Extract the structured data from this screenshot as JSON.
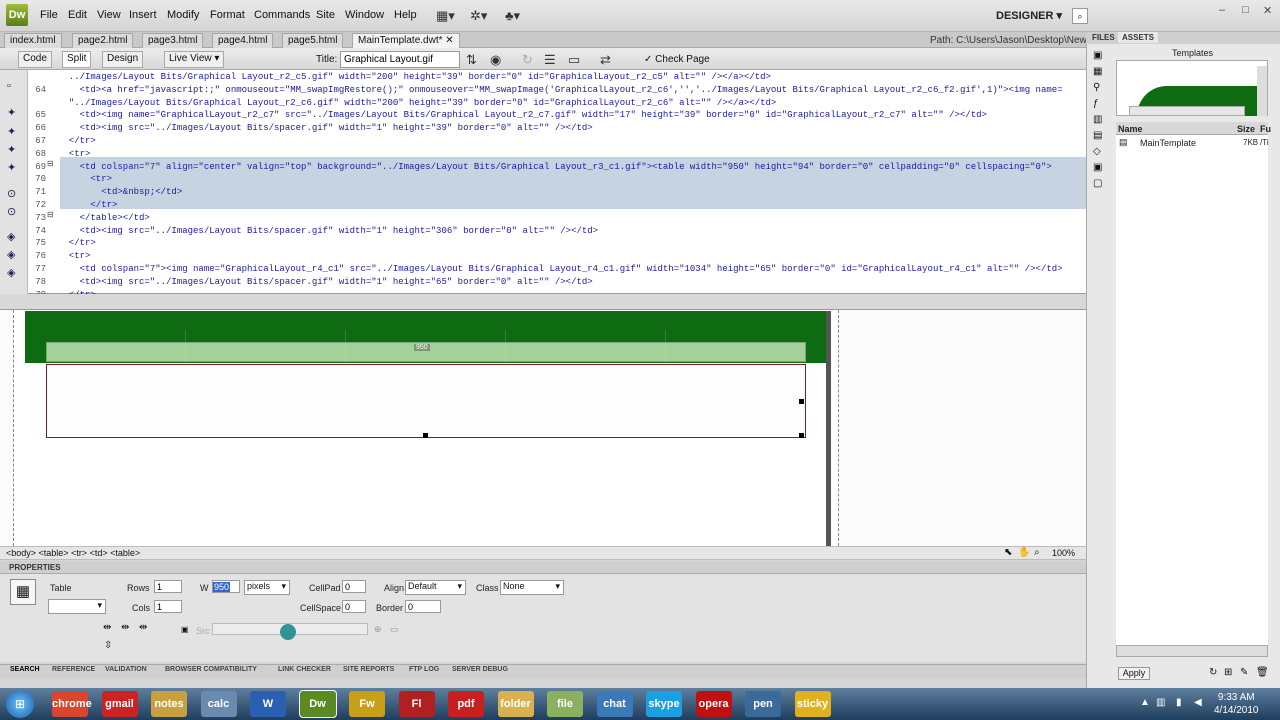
{
  "app": {
    "logo": "Dw",
    "workspace": "DESIGNER",
    "search_icon": "⌕"
  },
  "menu": [
    "File",
    "Edit",
    "View",
    "Insert",
    "Modify",
    "Format",
    "Commands",
    "Site",
    "Window",
    "Help"
  ],
  "window_controls": [
    "‒",
    "□",
    "✕"
  ],
  "doc_tabs": [
    "index.html",
    "page2.html",
    "page3.html",
    "page4.html",
    "page5.html",
    "MainTemplate.dwt*"
  ],
  "path": "Path:  C:\\Users\\Jason\\Desktop\\New Tr",
  "toolbar": {
    "code": "Code",
    "split": "Split",
    "design": "Design",
    "live_view": "Live View",
    "title_label": "Title:",
    "title_value": "Graphical Layout.gif",
    "check_page": "Check Page"
  },
  "code_lines": [
    {
      "n": "",
      "t": "  ../Images/Layout Bits/Graphical Layout_r2_c5.gif\" width=\"200\" height=\"39\" border=\"0\" id=\"GraphicalLayout_r2_c5\" alt=\"\" /></a></td>"
    },
    {
      "n": "64",
      "t": "    <td><a href=\"javascript:;\" onmouseout=\"MM_swapImgRestore();\" onmouseover=\"MM_swapImage('GraphicalLayout_r2_c6','','../Images/Layout Bits/Graphical Layout_r2_c6_f2.gif',1)\"><img name="
    },
    {
      "n": "",
      "t": "  \"../Images/Layout Bits/Graphical Layout_r2_c6.gif\" width=\"200\" height=\"39\" border=\"0\" id=\"GraphicalLayout_r2_c6\" alt=\"\" /></a></td>"
    },
    {
      "n": "65",
      "t": "    <td><img name=\"GraphicalLayout_r2_c7\" src=\"../Images/Layout Bits/Graphical Layout_r2_c7.gif\" width=\"17\" height=\"39\" border=\"0\" id=\"GraphicalLayout_r2_c7\" alt=\"\" /></td>"
    },
    {
      "n": "66",
      "t": "    <td><img src=\"../Images/Layout Bits/spacer.gif\" width=\"1\" height=\"39\" border=\"0\" alt=\"\" /></td>"
    },
    {
      "n": "67",
      "t": "  </tr>"
    },
    {
      "n": "68",
      "t": "  <tr>"
    },
    {
      "n": "69",
      "t": "    <td colspan=\"7\" align=\"center\" valign=\"top\" background=\"../Images/Layout Bits/Graphical Layout_r3_c1.gif\"><table width=\"950\" height=\"94\" border=\"0\" cellpadding=\"0\" cellspacing=\"0\">"
    },
    {
      "n": "70",
      "t": "      <tr>"
    },
    {
      "n": "71",
      "t": "        <td>&nbsp;</td>"
    },
    {
      "n": "72",
      "t": "      </tr>"
    },
    {
      "n": "73",
      "t": "    </table></td>"
    },
    {
      "n": "74",
      "t": "    <td><img src=\"../Images/Layout Bits/spacer.gif\" width=\"1\" height=\"306\" border=\"0\" alt=\"\" /></td>"
    },
    {
      "n": "75",
      "t": "  </tr>"
    },
    {
      "n": "76",
      "t": "  <tr>"
    },
    {
      "n": "77",
      "t": "    <td colspan=\"7\"><img name=\"GraphicalLayout_r4_c1\" src=\"../Images/Layout Bits/Graphical Layout_r4_c1.gif\" width=\"1034\" height=\"65\" border=\"0\" id=\"GraphicalLayout_r4_c1\" alt=\"\" /></td>"
    },
    {
      "n": "78",
      "t": "    <td><img src=\"../Images/Layout Bits/spacer.gif\" width=\"1\" height=\"65\" border=\"0\" alt=\"\" /></td>"
    },
    {
      "n": "79",
      "t": "  </tr>"
    }
  ],
  "design": {
    "width_label": "950"
  },
  "tag_selector": "<body> <table> <tr> <td> <table>",
  "zoom": "100%",
  "properties": {
    "header": "PROPERTIES",
    "type": "Table",
    "rows_label": "Rows",
    "rows": "1",
    "cols_label": "Cols",
    "cols": "1",
    "w_label": "W",
    "w": "950",
    "w_unit": "pixels",
    "cellpad_label": "CellPad",
    "cellpad": "0",
    "cellspace_label": "CellSpace",
    "cellspace": "0",
    "align_label": "Align",
    "align": "Default",
    "border_label": "Border",
    "border": "0",
    "class_label": "Class",
    "class": "None",
    "src_label": "Src"
  },
  "bottom_tabs": [
    "SEARCH",
    "REFERENCE",
    "VALIDATION",
    "BROWSER COMPATIBILITY",
    "LINK CHECKER",
    "SITE REPORTS",
    "FTP LOG",
    "SERVER DEBUG"
  ],
  "panel": {
    "tabs": [
      "FILES",
      "ASSETS"
    ],
    "heading": "Templates",
    "col_name": "Name",
    "col_size": "Size",
    "col_full": "Fu",
    "item_name": "MainTemplate",
    "item_size": "7KB",
    "item_full": "/Ti",
    "apply": "Apply"
  },
  "taskbar": {
    "apps": [
      "chrome",
      "gmail",
      "notes",
      "calc",
      "W",
      "Dw",
      "Fw",
      "Fl",
      "pdf",
      "folder",
      "file",
      "chat",
      "skype",
      "opera",
      "pen",
      "sticky"
    ],
    "time": "9:33 AM",
    "date": "4/14/2010"
  }
}
